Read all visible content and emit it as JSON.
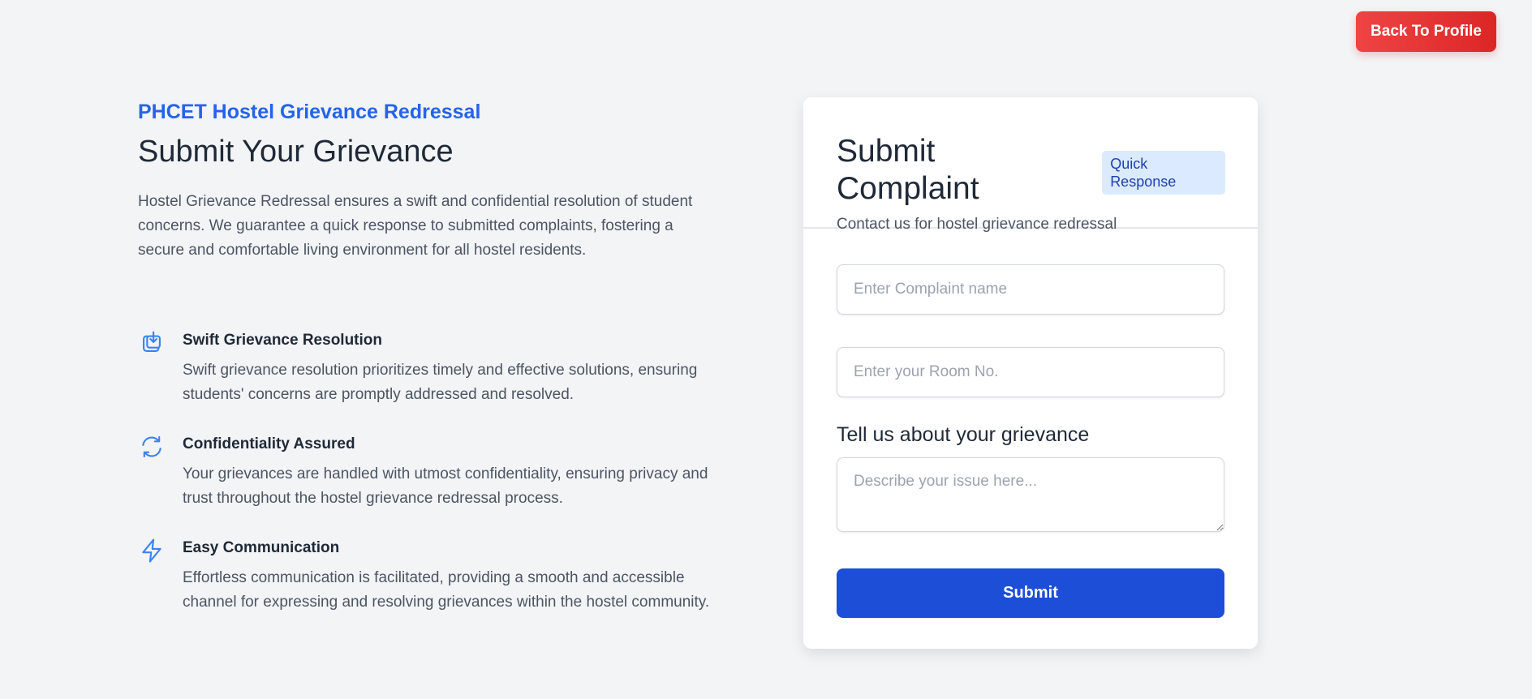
{
  "header": {
    "back_label": "Back To Profile"
  },
  "intro": {
    "eyebrow": "PHCET Hostel Grievance Redressal",
    "title": "Submit Your Grievance",
    "description": "Hostel Grievance Redressal ensures a swift and confidential resolution of student concerns. We guarantee a quick response to submitted complaints, fostering a secure and comfortable living environment for all hostel residents."
  },
  "features": [
    {
      "icon": "download-tray-icon",
      "title": "Swift Grievance Resolution",
      "text": "Swift grievance resolution prioritizes timely and effective solutions, ensuring students' concerns are promptly addressed and resolved."
    },
    {
      "icon": "refresh-icon",
      "title": "Confidentiality Assured",
      "text": "Your grievances are handled with utmost confidentiality, ensuring privacy and trust throughout the hostel grievance redressal process."
    },
    {
      "icon": "lightning-icon",
      "title": "Easy Communication",
      "text": "Effortless communication is facilitated, providing a smooth and accessible channel for expressing and resolving grievances within the hostel community."
    }
  ],
  "form": {
    "title": "Submit Complaint",
    "badge": "Quick Response",
    "subtitle": "Contact us for hostel grievance redressal",
    "complaint_name": {
      "value": "",
      "placeholder": "Enter Complaint name"
    },
    "room_no": {
      "value": "",
      "placeholder": "Enter your Room No."
    },
    "description_label": "Tell us about your grievance",
    "description": {
      "value": "",
      "placeholder": "Describe your issue here..."
    },
    "submit_label": "Submit"
  },
  "colors": {
    "accent": "#2563eb",
    "primary_button": "#1d4ed8",
    "danger_button": "#dc2626",
    "background": "#f3f4f6"
  }
}
